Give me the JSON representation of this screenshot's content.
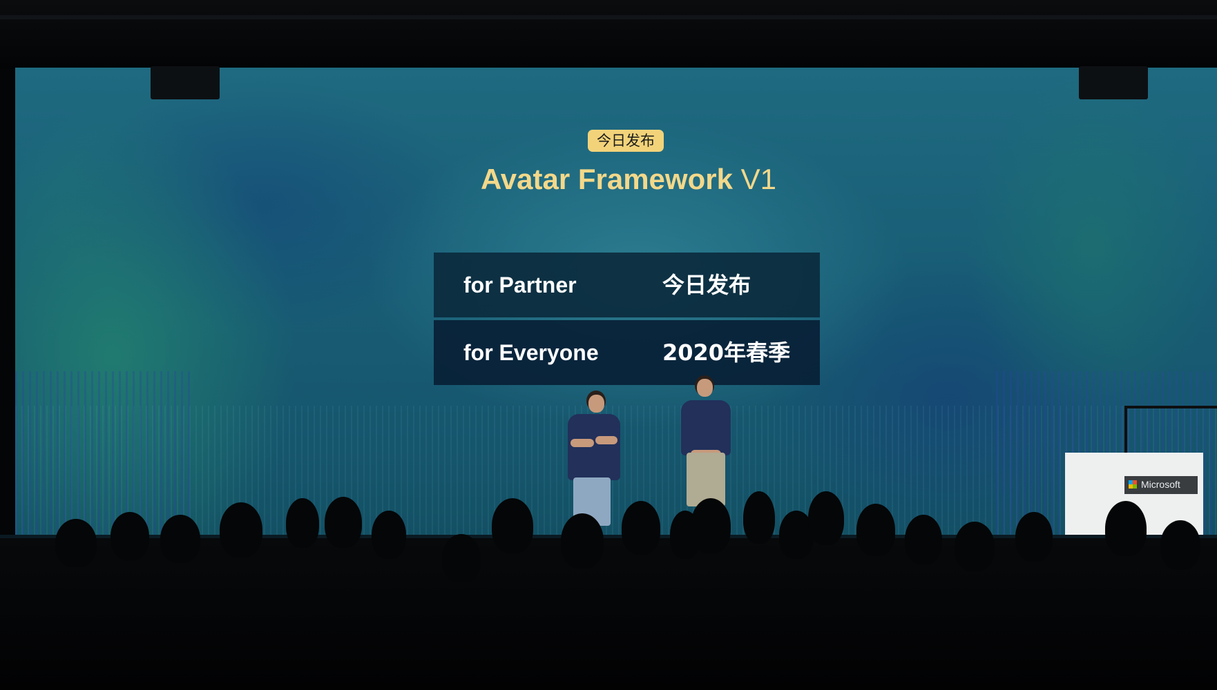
{
  "slide": {
    "badge": "今日发布",
    "title_main": "Avatar Framework ",
    "title_version": "V1",
    "rows": [
      {
        "label": "for Partner",
        "value": "今日发布"
      },
      {
        "label": "for Everyone",
        "value": "2020年春季"
      }
    ]
  },
  "podium": {
    "logo_text": "Microsoft"
  },
  "colors": {
    "screen_teal": "#1b6378",
    "badge_yellow": "#f2d37a",
    "title_gold": "#f3d88a",
    "table_navy": "#0a283a",
    "shirt_navy": "#22305a"
  }
}
